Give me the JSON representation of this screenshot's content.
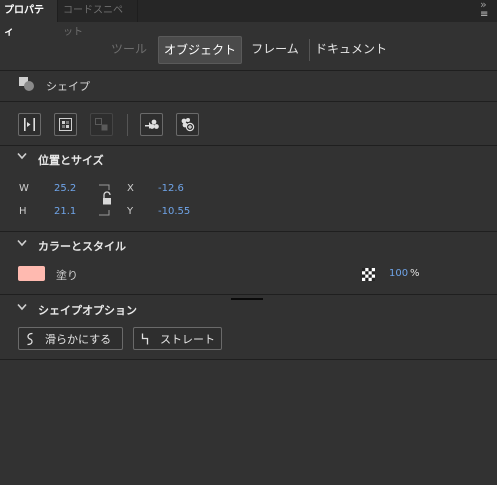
{
  "tabs": {
    "properties": "プロパティ",
    "code_snippets": "コードスニペット",
    "collapse_glyph": "»",
    "menu_glyph": "≡"
  },
  "modes": {
    "tool": "ツール",
    "object": "オブジェクト",
    "frame": "フレーム",
    "document": "ドキュメント"
  },
  "object": {
    "type_label": "シェイプ"
  },
  "position_size": {
    "title": "位置とサイズ",
    "w_label": "W",
    "w_value": "25.2",
    "h_label": "H",
    "h_value": "21.1",
    "x_label": "X",
    "x_value": "-12.6",
    "y_label": "Y",
    "y_value": "-10.55"
  },
  "color_style": {
    "title": "カラーとスタイル",
    "fill_label": "塗り",
    "fill_color": "#ffbab0",
    "opacity_value": "100",
    "opacity_unit": "%"
  },
  "shape_options": {
    "title": "シェイプオプション",
    "smooth_label": "滑らかにする",
    "straighten_label": "ストレート"
  },
  "colors": {
    "panel_bg": "#323232",
    "accent_value": "#6fa4e8"
  }
}
